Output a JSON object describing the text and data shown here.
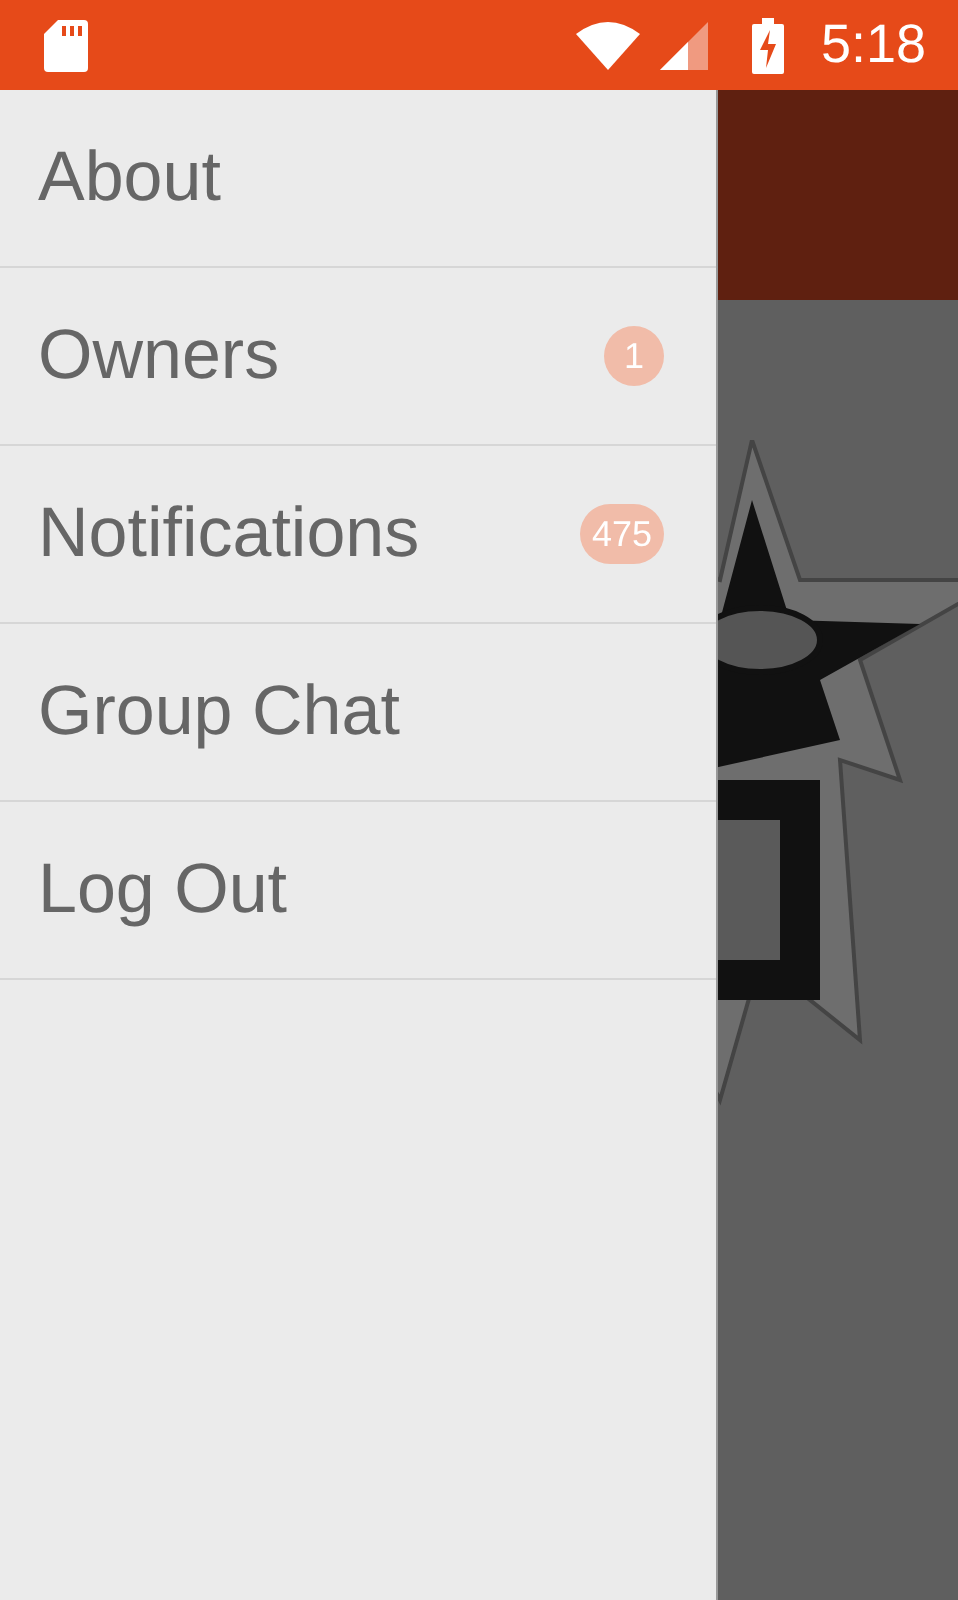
{
  "status_bar": {
    "time": "5:18"
  },
  "drawer": {
    "items": [
      {
        "label": "About"
      },
      {
        "label": "Owners",
        "badge": "1"
      },
      {
        "label": "Notifications",
        "badge": "475"
      },
      {
        "label": "Group Chat"
      },
      {
        "label": "Log Out"
      }
    ]
  }
}
